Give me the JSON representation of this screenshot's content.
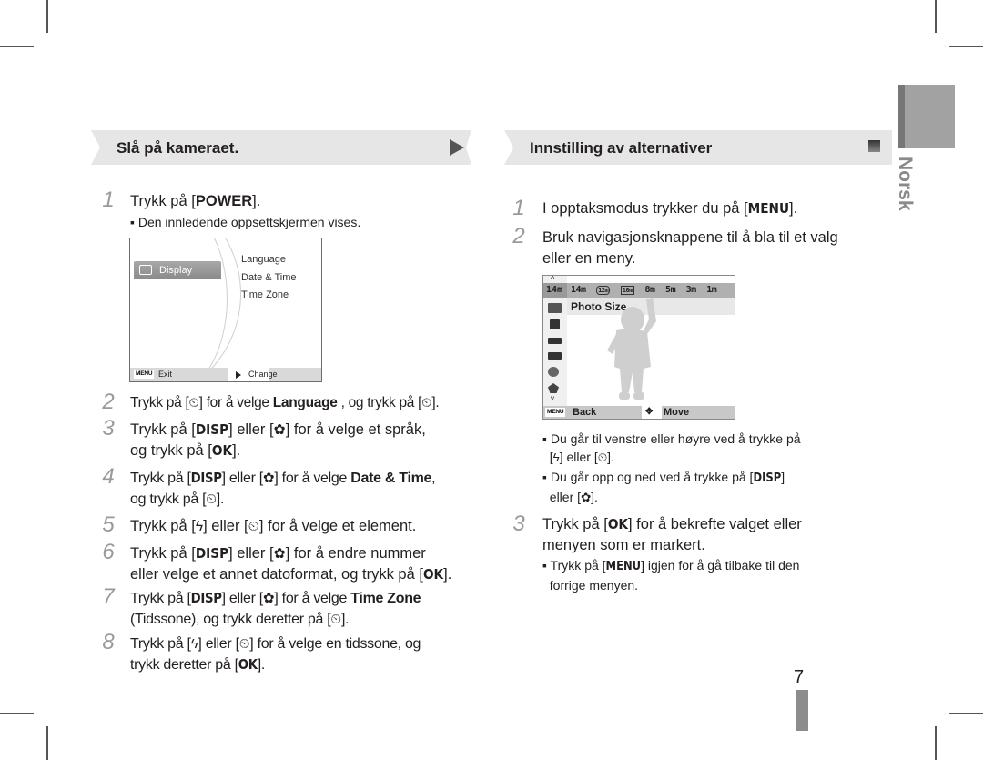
{
  "left_section": {
    "title": "Slå på kameraet.",
    "header_icon": "play-icon",
    "steps": [
      {
        "num": "1",
        "text_parts": [
          "Trykk på [",
          "POWER",
          "]."
        ]
      },
      {
        "num": "2"
      },
      {
        "num": "3"
      },
      {
        "num": "4"
      },
      {
        "num": "5"
      },
      {
        "num": "6"
      },
      {
        "num": "7"
      },
      {
        "num": "8"
      }
    ],
    "step1_bullet": "Den innledende oppsettskjermen vises.",
    "step2": {
      "a": "Trykk på [",
      "icon": "timer-icon",
      "b": "] for å velge ",
      "bold": "Language",
      "c": " , og trykk på [",
      "d": "]."
    },
    "step3": {
      "a": "Trykk på [",
      "key1": "DISP",
      "b": "] eller [",
      "icon": "macro-icon",
      "c": "] for å velge et språk,",
      "line2a": "og trykk på [",
      "key2": "OK",
      "line2b": "]."
    },
    "step4": {
      "a": "Trykk på [",
      "key1": "DISP",
      "b": "] eller [",
      "c": "] for å velge ",
      "bold": "Date & Time",
      "d": ",",
      "line2a": "og trykk på [",
      "line2b": "]."
    },
    "step5": {
      "a": "Trykk på [",
      "b": "] eller [",
      "c": "] for å velge et element."
    },
    "step6": {
      "a": "Trykk på [",
      "key1": "DISP",
      "b": "] eller [",
      "c": "] for å endre nummer",
      "line2a": "eller velge et annet datoformat, og trykk på [",
      "key2": "OK",
      "line2b": "]."
    },
    "step7": {
      "a": "Trykk på [",
      "key1": "DISP",
      "b": "] eller [",
      "c": "] for å velge ",
      "bold": "Time Zone",
      "line2a": "(Tidssone), og trykk deretter på [",
      "line2b": "]."
    },
    "step8": {
      "a": "Trykk på [",
      "b": "] eller [",
      "c": "] for å velge en tidssone, og",
      "line2a": "trykk deretter på [",
      "key2": "OK",
      "line2b": "]."
    },
    "screen": {
      "selected_item": "Display",
      "options": [
        "Language",
        "Date & Time",
        "Time Zone"
      ],
      "footer_left_key": "MENU",
      "footer_left": "Exit",
      "footer_right": "Change"
    }
  },
  "right_section": {
    "title": "Innstilling av alternativer",
    "header_icon": "stop-icon",
    "step_nums": [
      "1",
      "2",
      "3"
    ],
    "step1": {
      "a": "I opptaksmodus trykker du på [",
      "key": "MENU",
      "b": "]."
    },
    "step2": {
      "line1": "Bruk navigasjonsknappene til å bla til et valg",
      "line2": "eller en meny."
    },
    "bullets": [
      {
        "line1": "Du går til venstre eller høyre ved å trykke på",
        "line2a": "[",
        "line2b": "] eller [",
        "line2c": "]."
      },
      {
        "line1a": "Du går opp og ned ved å trykke på [",
        "key": "DISP",
        "line1b": "]",
        "line2a": "eller [",
        "line2b": "]."
      }
    ],
    "step3": {
      "a": "Trykk på [",
      "key": "OK",
      "b": "] for å bekrefte valget eller",
      "line2": "menyen som er markert."
    },
    "step3_bullet": {
      "a": "Trykk på [",
      "key": "MENU",
      "b": "] igjen for å gå tilbake til den",
      "line2": "forrige menyen."
    },
    "screen": {
      "size_options": [
        "14m",
        "14m",
        "12m",
        "10m",
        "8m",
        "5m",
        "3m",
        "1m"
      ],
      "current_size": "14m",
      "menu_label": "Photo Size",
      "footer_left_key": "MENU",
      "footer_left": "Back",
      "footer_right": "Move"
    }
  },
  "sidebar": {
    "language": "Norsk"
  },
  "page_number": "7",
  "colors": {
    "header_bg": "#e6e6e6",
    "step_num": "#9a9a9a",
    "tab": "#a2a2a2",
    "page_bar": "#8c8c8c"
  }
}
